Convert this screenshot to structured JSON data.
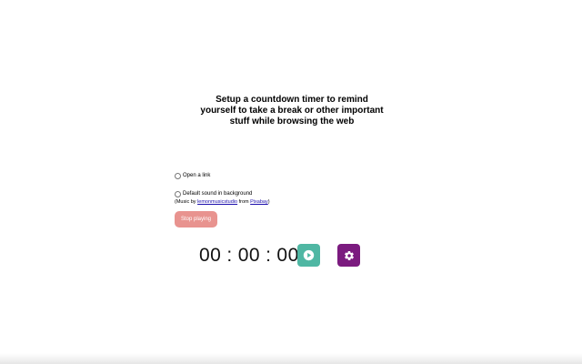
{
  "header": {
    "description": "Setup a countdown timer to remind yourself to take a break or other important stuff while browsing the web"
  },
  "options": {
    "open_link_label": "Open a link",
    "default_sound_label": "Default sound in background"
  },
  "music_credit": {
    "prefix": "(Music by ",
    "artist": "lemonmusicstudio",
    "middle": " from ",
    "source": "Pixabay",
    "suffix": ")"
  },
  "buttons": {
    "stop_label": "Stop playing"
  },
  "timer": {
    "hours": "00",
    "minutes": "00",
    "seconds": "00",
    "separator": ":"
  },
  "colors": {
    "stop_button": "#e8938f",
    "play_button": "#4fb7a3",
    "settings_button": "#7b1b7f"
  },
  "icons": {
    "play": "play-circle-icon",
    "settings": "gear-icon"
  }
}
